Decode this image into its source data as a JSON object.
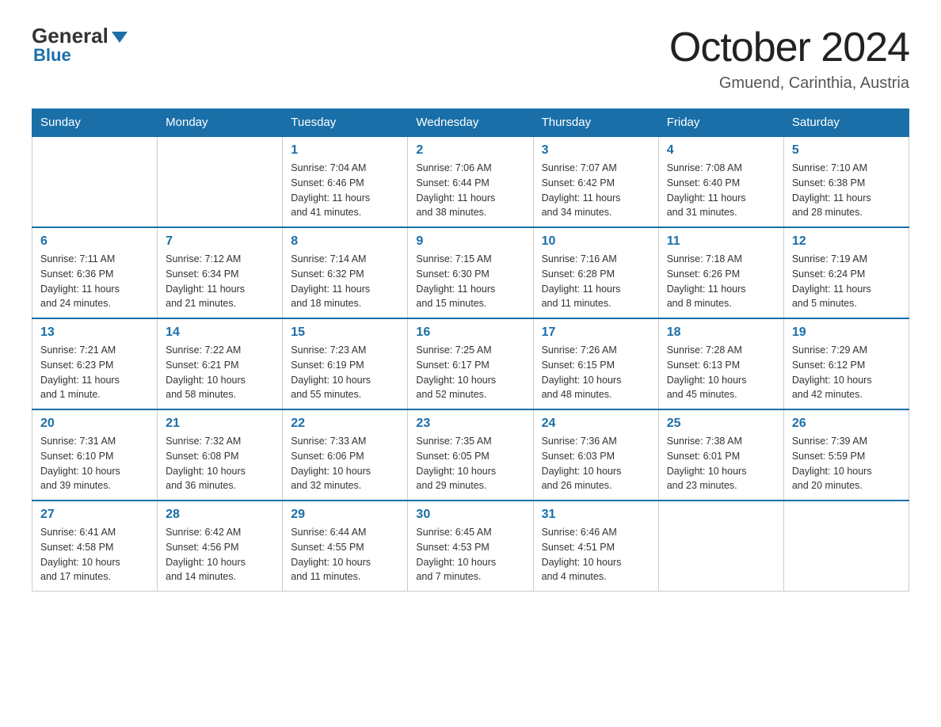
{
  "logo": {
    "general": "General",
    "triangle": "",
    "blue": "Blue"
  },
  "title": "October 2024",
  "location": "Gmuend, Carinthia, Austria",
  "days_of_week": [
    "Sunday",
    "Monday",
    "Tuesday",
    "Wednesday",
    "Thursday",
    "Friday",
    "Saturday"
  ],
  "weeks": [
    [
      {
        "day": "",
        "info": ""
      },
      {
        "day": "",
        "info": ""
      },
      {
        "day": "1",
        "info": "Sunrise: 7:04 AM\nSunset: 6:46 PM\nDaylight: 11 hours\nand 41 minutes."
      },
      {
        "day": "2",
        "info": "Sunrise: 7:06 AM\nSunset: 6:44 PM\nDaylight: 11 hours\nand 38 minutes."
      },
      {
        "day": "3",
        "info": "Sunrise: 7:07 AM\nSunset: 6:42 PM\nDaylight: 11 hours\nand 34 minutes."
      },
      {
        "day": "4",
        "info": "Sunrise: 7:08 AM\nSunset: 6:40 PM\nDaylight: 11 hours\nand 31 minutes."
      },
      {
        "day": "5",
        "info": "Sunrise: 7:10 AM\nSunset: 6:38 PM\nDaylight: 11 hours\nand 28 minutes."
      }
    ],
    [
      {
        "day": "6",
        "info": "Sunrise: 7:11 AM\nSunset: 6:36 PM\nDaylight: 11 hours\nand 24 minutes."
      },
      {
        "day": "7",
        "info": "Sunrise: 7:12 AM\nSunset: 6:34 PM\nDaylight: 11 hours\nand 21 minutes."
      },
      {
        "day": "8",
        "info": "Sunrise: 7:14 AM\nSunset: 6:32 PM\nDaylight: 11 hours\nand 18 minutes."
      },
      {
        "day": "9",
        "info": "Sunrise: 7:15 AM\nSunset: 6:30 PM\nDaylight: 11 hours\nand 15 minutes."
      },
      {
        "day": "10",
        "info": "Sunrise: 7:16 AM\nSunset: 6:28 PM\nDaylight: 11 hours\nand 11 minutes."
      },
      {
        "day": "11",
        "info": "Sunrise: 7:18 AM\nSunset: 6:26 PM\nDaylight: 11 hours\nand 8 minutes."
      },
      {
        "day": "12",
        "info": "Sunrise: 7:19 AM\nSunset: 6:24 PM\nDaylight: 11 hours\nand 5 minutes."
      }
    ],
    [
      {
        "day": "13",
        "info": "Sunrise: 7:21 AM\nSunset: 6:23 PM\nDaylight: 11 hours\nand 1 minute."
      },
      {
        "day": "14",
        "info": "Sunrise: 7:22 AM\nSunset: 6:21 PM\nDaylight: 10 hours\nand 58 minutes."
      },
      {
        "day": "15",
        "info": "Sunrise: 7:23 AM\nSunset: 6:19 PM\nDaylight: 10 hours\nand 55 minutes."
      },
      {
        "day": "16",
        "info": "Sunrise: 7:25 AM\nSunset: 6:17 PM\nDaylight: 10 hours\nand 52 minutes."
      },
      {
        "day": "17",
        "info": "Sunrise: 7:26 AM\nSunset: 6:15 PM\nDaylight: 10 hours\nand 48 minutes."
      },
      {
        "day": "18",
        "info": "Sunrise: 7:28 AM\nSunset: 6:13 PM\nDaylight: 10 hours\nand 45 minutes."
      },
      {
        "day": "19",
        "info": "Sunrise: 7:29 AM\nSunset: 6:12 PM\nDaylight: 10 hours\nand 42 minutes."
      }
    ],
    [
      {
        "day": "20",
        "info": "Sunrise: 7:31 AM\nSunset: 6:10 PM\nDaylight: 10 hours\nand 39 minutes."
      },
      {
        "day": "21",
        "info": "Sunrise: 7:32 AM\nSunset: 6:08 PM\nDaylight: 10 hours\nand 36 minutes."
      },
      {
        "day": "22",
        "info": "Sunrise: 7:33 AM\nSunset: 6:06 PM\nDaylight: 10 hours\nand 32 minutes."
      },
      {
        "day": "23",
        "info": "Sunrise: 7:35 AM\nSunset: 6:05 PM\nDaylight: 10 hours\nand 29 minutes."
      },
      {
        "day": "24",
        "info": "Sunrise: 7:36 AM\nSunset: 6:03 PM\nDaylight: 10 hours\nand 26 minutes."
      },
      {
        "day": "25",
        "info": "Sunrise: 7:38 AM\nSunset: 6:01 PM\nDaylight: 10 hours\nand 23 minutes."
      },
      {
        "day": "26",
        "info": "Sunrise: 7:39 AM\nSunset: 5:59 PM\nDaylight: 10 hours\nand 20 minutes."
      }
    ],
    [
      {
        "day": "27",
        "info": "Sunrise: 6:41 AM\nSunset: 4:58 PM\nDaylight: 10 hours\nand 17 minutes."
      },
      {
        "day": "28",
        "info": "Sunrise: 6:42 AM\nSunset: 4:56 PM\nDaylight: 10 hours\nand 14 minutes."
      },
      {
        "day": "29",
        "info": "Sunrise: 6:44 AM\nSunset: 4:55 PM\nDaylight: 10 hours\nand 11 minutes."
      },
      {
        "day": "30",
        "info": "Sunrise: 6:45 AM\nSunset: 4:53 PM\nDaylight: 10 hours\nand 7 minutes."
      },
      {
        "day": "31",
        "info": "Sunrise: 6:46 AM\nSunset: 4:51 PM\nDaylight: 10 hours\nand 4 minutes."
      },
      {
        "day": "",
        "info": ""
      },
      {
        "day": "",
        "info": ""
      }
    ]
  ]
}
